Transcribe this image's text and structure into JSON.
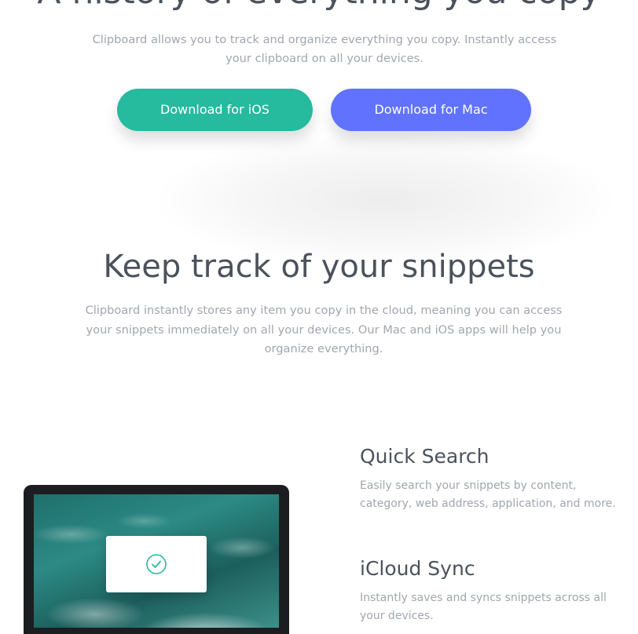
{
  "hero": {
    "title": "A history of everything you copy",
    "subtitle": "Clipboard allows you to track and organize everything you copy. Instantly access your clipboard on all your devices.",
    "ios_button_label": "Download for iOS",
    "mac_button_label": "Download for Mac"
  },
  "snippets": {
    "title": "Keep track of your snippets",
    "description": "Clipboard instantly stores any item you copy in the cloud, meaning you can access your snippets immediately on all your devices. Our Mac and iOS apps will help you organize everything."
  },
  "features": [
    {
      "title": "Quick Search",
      "description": "Easily search your snippets by content, category, web address, application, and more."
    },
    {
      "title": "iCloud Sync",
      "description": "Instantly saves and syncs snippets across all your devices."
    }
  ],
  "icons": {
    "device_card_icon": "checkmark-circle-icon"
  },
  "colors": {
    "ios_button": "#26ba9f",
    "mac_button": "#6173fe",
    "heading": "#4b525c",
    "body_text": "#a1a6ae"
  }
}
